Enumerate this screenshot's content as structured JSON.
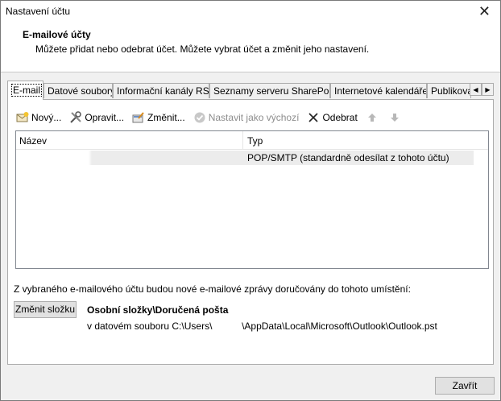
{
  "window": {
    "title": "Nastavení účtu",
    "close_glyph": "✕"
  },
  "header": {
    "title": "E-mailové účty",
    "subtitle": "Můžete přidat nebo odebrat účet. Můžete vybrat účet a změnit jeho nastavení."
  },
  "tabs": [
    {
      "label": "E-mail",
      "active": true
    },
    {
      "label": "Datové soubory"
    },
    {
      "label": "Informační kanály RSS"
    },
    {
      "label": "Seznamy serveru SharePoint"
    },
    {
      "label": "Internetové kalendáře"
    },
    {
      "label": "Publikovan"
    }
  ],
  "tab_scroll": {
    "left": "◀",
    "right": "▶"
  },
  "toolbar": {
    "new_label": "Nový...",
    "repair_label": "Opravit...",
    "change_label": "Změnit...",
    "set_default_label": "Nastavit jako výchozí",
    "remove_label": "Odebrat"
  },
  "accounts": {
    "columns": [
      "Název",
      "Typ"
    ],
    "rows": [
      {
        "name": "",
        "type": "POP/SMTP (standardně odesílat z tohoto účtu)"
      }
    ]
  },
  "delivery": {
    "label": "Z vybraného e-mailového účtu budou nové e-mailové zprávy doručovány do tohoto umístění:",
    "change_folder_label": "Změnit složku",
    "folder": "Osobní složky\\Doručená pošta",
    "path": "v datovém souboru C:\\Users\\           \\AppData\\Local\\Microsoft\\Outlook\\Outlook.pst"
  },
  "footer": {
    "close_label": "Zavřít"
  },
  "colors": {
    "window_bg": "#f0f0f0",
    "selected_row": "#ececec",
    "disabled_text": "#8d8d8d"
  }
}
